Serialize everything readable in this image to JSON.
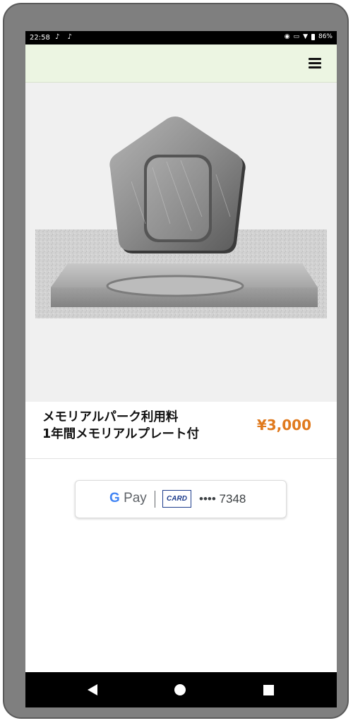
{
  "status_bar": {
    "time": "22:58",
    "notifications": "♪ ♪",
    "battery": "86%"
  },
  "header": {
    "menu_icon": "hamburger-menu-icon"
  },
  "hero": {
    "image": "memorial-stone-plate"
  },
  "product": {
    "name_line1": "メモリアルパーク利用料",
    "name_line2": "1年間メモリアルプレート付",
    "price": "¥3,000"
  },
  "payment": {
    "brand": "Pay",
    "card_label": "CARD",
    "card_number": "•••• 7348"
  },
  "navigation": {
    "back_icon": "back-triangle-icon",
    "home_icon": "home-circle-icon",
    "recent_icon": "recent-square-icon"
  },
  "colors": {
    "header_bg": "#ecf5e2",
    "price": "#e07a1e",
    "card_badge": "#1d3c8c"
  }
}
